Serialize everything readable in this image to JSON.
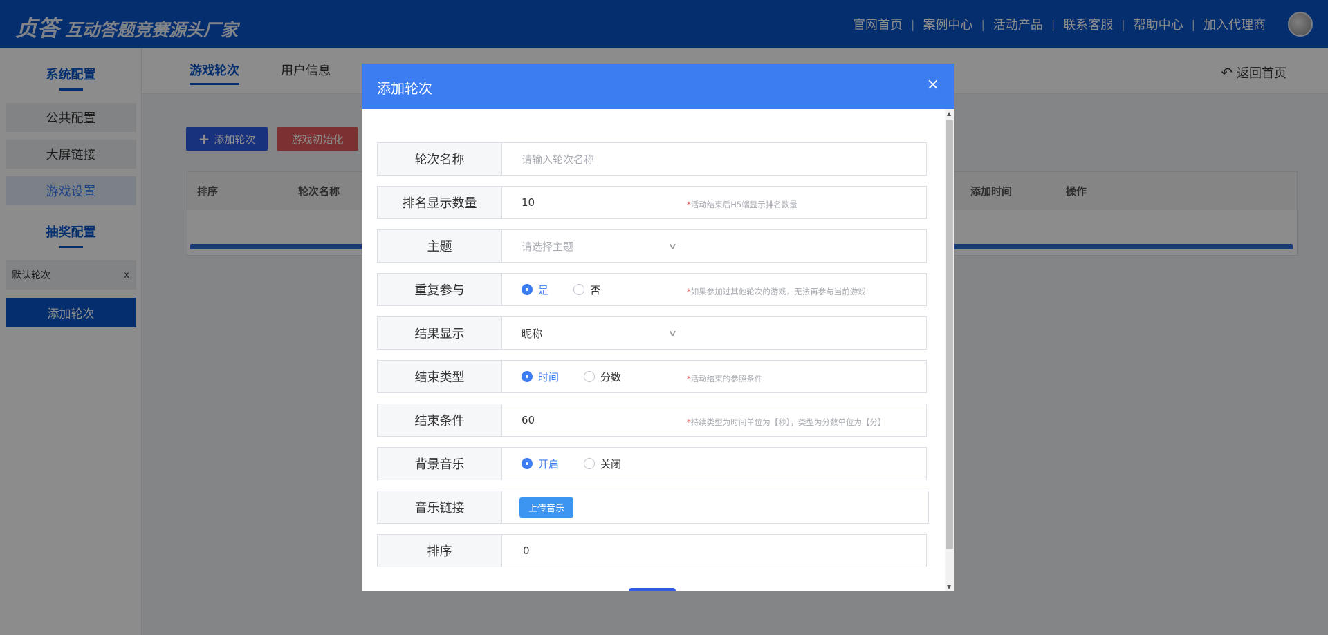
{
  "header": {
    "brand": "贞答",
    "slogan": "互动答题竞赛源头厂家",
    "nav": [
      "官网首页",
      "案例中心",
      "活动产品",
      "联系客服",
      "帮助中心",
      "加入代理商"
    ],
    "separator": "|"
  },
  "sidebar": {
    "system_heading": "系统配置",
    "items": [
      {
        "label": "公共配置",
        "active": false
      },
      {
        "label": "大屏链接",
        "active": false
      },
      {
        "label": "游戏设置",
        "active": true
      }
    ],
    "lottery_heading": "抽奖配置",
    "round_tag": {
      "label": "默认轮次",
      "close": "x"
    },
    "add_round": "添加轮次"
  },
  "main": {
    "tabs": [
      {
        "label": "游戏轮次",
        "active": true
      },
      {
        "label": "用户信息",
        "active": false
      }
    ],
    "back_home": "返回首页",
    "add_round_button": "添加轮次",
    "init_button": "游戏初始化",
    "table_headers": [
      "排序",
      "轮次名称",
      "添加时间",
      "操作"
    ]
  },
  "modal": {
    "title": "添加轮次",
    "close": "×",
    "rows": {
      "round_name": {
        "label": "轮次名称",
        "placeholder": "请输入轮次名称"
      },
      "rank_count": {
        "label": "排名显示数量",
        "value": "10",
        "hint": "活动结束后H5端显示排名数量"
      },
      "theme": {
        "label": "主题",
        "placeholder": "请选择主题"
      },
      "repeat": {
        "label": "重复参与",
        "options": [
          "是",
          "否"
        ],
        "selected": "是",
        "hint": "如果参加过其他轮次的游戏，无法再参与当前游戏"
      },
      "result_display": {
        "label": "结果显示",
        "value": "昵称"
      },
      "end_type": {
        "label": "结束类型",
        "options": [
          "时间",
          "分数"
        ],
        "selected": "时间",
        "hint": "活动结束的参照条件"
      },
      "end_condition": {
        "label": "结束条件",
        "value": "60",
        "hint": "持续类型为时间单位为【秒】，类型为分数单位为【分】"
      },
      "bg_music": {
        "label": "背景音乐",
        "options": [
          "开启",
          "关闭"
        ],
        "selected": "开启"
      },
      "music_link": {
        "label": "音乐链接",
        "button": "上传音乐"
      },
      "sort": {
        "label": "排序",
        "value": "0"
      }
    },
    "hint_marker": "*"
  },
  "colors": {
    "header_blue": "#0a55c8",
    "modal_header": "#3d7df2",
    "danger": "#e4585a",
    "primary_button": "#2f5ce6"
  }
}
